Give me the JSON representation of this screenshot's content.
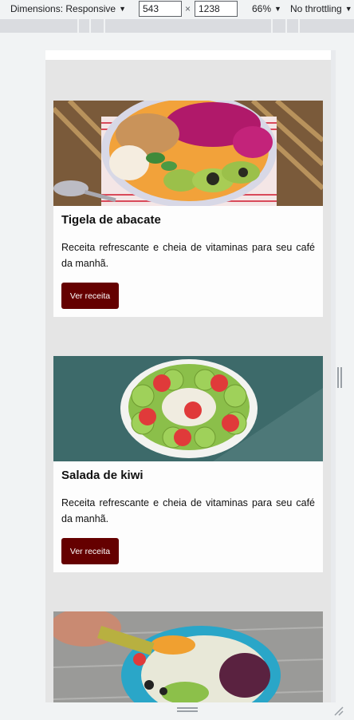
{
  "toolbar": {
    "dimensions_label": "Dimensions: Responsive",
    "width": "543",
    "height": "1238",
    "times": "×",
    "zoom": "66%",
    "throttling": "No throttling"
  },
  "cards": [
    {
      "title": "Tigela de abacate",
      "description": "Receita refrescante e cheia de vitaminas para seu café da manhã.",
      "button": "Ver receita"
    },
    {
      "title": "Salada de kiwi",
      "description": "Receita refrescante e cheia de vitaminas para seu café da manhã.",
      "button": "Ver receita"
    }
  ],
  "colors": {
    "button_bg": "#650000",
    "page_bg": "#e5e5e5"
  },
  "icons": [
    "caret-down-icon",
    "resize-handle-icon"
  ]
}
